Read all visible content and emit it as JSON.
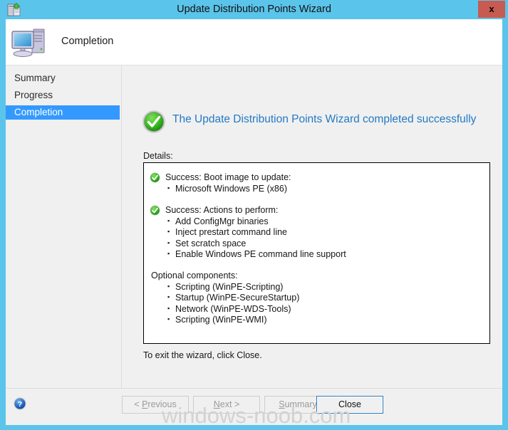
{
  "window": {
    "title": "Update Distribution Points Wizard",
    "title_icon": "distribution-point-icon",
    "close_label": "x",
    "frame_color": "#5bc4ea",
    "close_button_color": "#c75b51"
  },
  "banner": {
    "icon": "computer-icon",
    "title": "Completion"
  },
  "sidebar": {
    "items": [
      {
        "label": "Summary",
        "selected": false
      },
      {
        "label": "Progress",
        "selected": false
      },
      {
        "label": "Completion",
        "selected": true
      }
    ],
    "highlight_color": "#3399ff"
  },
  "content": {
    "success_icon": "success-check-icon",
    "success_heading": "The Update Distribution Points Wizard completed successfully",
    "success_heading_color": "#2379c4",
    "details_label": "Details:",
    "details_groups": [
      {
        "icon": "success-check-badge-icon",
        "heading": "Success: Boot image to update:",
        "items": [
          "Microsoft Windows PE (x86)"
        ]
      },
      {
        "icon": "success-check-badge-icon",
        "heading": "Success: Actions to perform:",
        "items": [
          "Add ConfigMgr binaries",
          "Inject prestart command line",
          "Set scratch space",
          "Enable Windows PE command line support"
        ]
      },
      {
        "icon": null,
        "heading": "Optional components:",
        "items": [
          "Scripting (WinPE-Scripting)",
          "Startup (WinPE-SecureStartup)",
          "Network (WinPE-WDS-Tools)",
          "Scripting (WinPE-WMI)"
        ]
      }
    ],
    "exit_text": "To exit the wizard, click Close."
  },
  "footer": {
    "help_icon": "help-question-icon",
    "buttons": [
      {
        "name": "previous",
        "prefix": "< ",
        "accel": "P",
        "rest": "revious",
        "suffix": "",
        "enabled": false
      },
      {
        "name": "next",
        "prefix": "",
        "accel": "N",
        "rest": "ext",
        "suffix": " >",
        "enabled": false
      },
      {
        "name": "summary",
        "prefix": "",
        "accel": "S",
        "rest": "ummary",
        "suffix": "",
        "enabled": false
      },
      {
        "name": "close",
        "prefix": "",
        "accel": "",
        "rest": "Close",
        "suffix": "",
        "enabled": true
      }
    ]
  },
  "watermark": {
    "text": "windows-noob.com",
    "color": "#d2d2d2"
  }
}
